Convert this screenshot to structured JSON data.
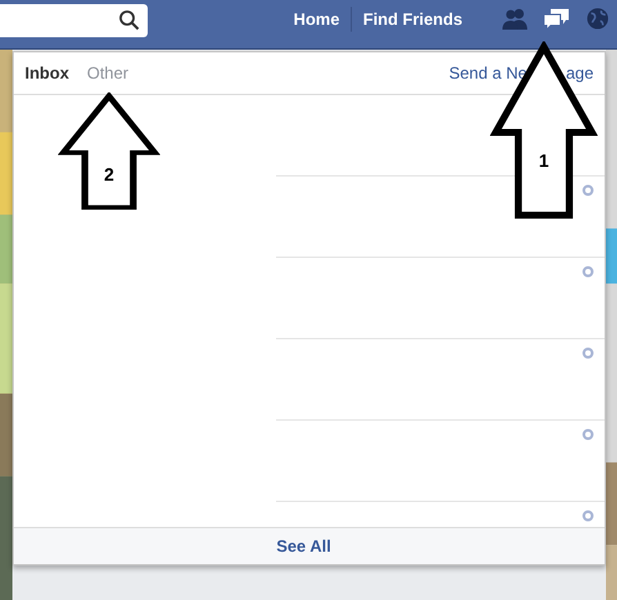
{
  "top_bar": {
    "nav_links": [
      "Home",
      "Find Friends"
    ],
    "icons": [
      {
        "kind": "friends",
        "active": false
      },
      {
        "kind": "messages",
        "active": true
      },
      {
        "kind": "globe",
        "active": false
      }
    ]
  },
  "messages_panel": {
    "tabs": [
      {
        "label": "Inbox",
        "selected": true
      },
      {
        "label": "Other",
        "selected": false
      }
    ],
    "new_message_link_parts": [
      "Send a Ne",
      "age"
    ],
    "rows": [
      {
        "read": true
      },
      {
        "read": true
      },
      {
        "read": true
      },
      {
        "read": true
      },
      {
        "read": true
      }
    ],
    "see_all": "See All"
  },
  "annotations": [
    {
      "number": "1"
    },
    {
      "number": "2"
    }
  ]
}
